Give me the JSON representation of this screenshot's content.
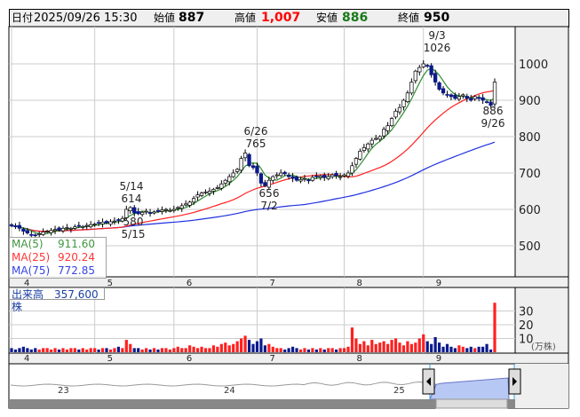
{
  "header": {
    "date_label": "日付",
    "date": "2025/09/26 15:30",
    "open_label": "始値",
    "open": "887",
    "high_label": "高値",
    "high": "1,007",
    "low_label": "安値",
    "low": "886",
    "close_label": "終値",
    "close": "950"
  },
  "colors": {
    "up": "#ffffff",
    "down": "#0a1a8c",
    "ma5": "#2e8b2e",
    "ma25": "#ff2020",
    "ma75": "#2030e0",
    "vol_up": "#ff2020",
    "vol_down": "#0a1a8c",
    "high_text": "#ff0000",
    "low_text": "#1a7a1a"
  },
  "legend": {
    "ma5_label": "MA(5)",
    "ma5": "911.60",
    "ma25_label": "MA(25)",
    "ma25": "920.24",
    "ma75_label": "MA(75)",
    "ma75": "772.85"
  },
  "volume_label": "出来高　357,600株",
  "volume_unit": "(万株)",
  "chart_data": {
    "type": "candlestick",
    "price_ticks": [
      500,
      600,
      700,
      800,
      900,
      1000
    ],
    "ylim": [
      420,
      1100
    ],
    "month_labels": [
      "4",
      "5",
      "6",
      "7",
      "8",
      "9"
    ],
    "month_start_index": [
      0,
      21,
      41,
      62,
      84,
      104
    ],
    "closes": [
      555,
      552,
      548,
      540,
      535,
      530,
      528,
      533,
      538,
      540,
      542,
      545,
      543,
      548,
      550,
      548,
      552,
      555,
      553,
      556,
      558,
      560,
      562,
      565,
      563,
      566,
      568,
      570,
      575,
      600,
      605,
      590,
      588,
      592,
      595,
      590,
      593,
      596,
      598,
      600,
      597,
      600,
      605,
      610,
      615,
      620,
      630,
      640,
      645,
      648,
      650,
      655,
      660,
      670,
      680,
      690,
      700,
      710,
      740,
      755,
      720,
      715,
      700,
      672,
      665,
      680,
      690,
      695,
      700,
      698,
      690,
      685,
      680,
      682,
      685,
      680,
      688,
      690,
      692,
      688,
      690,
      695,
      692,
      690,
      695,
      700,
      720,
      740,
      760,
      770,
      780,
      790,
      795,
      800,
      820,
      830,
      850,
      870,
      880,
      900,
      920,
      950,
      980,
      990,
      1000,
      995,
      970,
      950,
      930,
      920,
      915,
      910,
      905,
      910,
      915,
      905,
      900,
      910,
      905,
      900,
      895,
      886,
      950
    ],
    "volumes": [
      3,
      2,
      3,
      4,
      3,
      2,
      3,
      2,
      3,
      3,
      2,
      3,
      2,
      3,
      2,
      3,
      3,
      2,
      3,
      2,
      3,
      3,
      2,
      3,
      3,
      2,
      3,
      4,
      3,
      9,
      6,
      3,
      3,
      2,
      3,
      2,
      3,
      2,
      3,
      3,
      2,
      3,
      4,
      3,
      3,
      5,
      4,
      3,
      4,
      3,
      3,
      5,
      4,
      6,
      7,
      5,
      6,
      8,
      10,
      12,
      9,
      6,
      8,
      10,
      5,
      6,
      4,
      3,
      3,
      2,
      3,
      4,
      3,
      2,
      3,
      2,
      3,
      2,
      3,
      2,
      3,
      3,
      2,
      3,
      3,
      4,
      18,
      10,
      6,
      8,
      5,
      9,
      6,
      7,
      8,
      6,
      9,
      10,
      7,
      5,
      8,
      6,
      7,
      10,
      13,
      8,
      6,
      11,
      7,
      4,
      6,
      4,
      3,
      5,
      4,
      3,
      4,
      3,
      4,
      4,
      6,
      2,
      36
    ],
    "volume_ticks": [
      10,
      20,
      30
    ],
    "annotations": [
      {
        "date": "9/3",
        "price": "1026"
      },
      {
        "date": "6/26",
        "price": "765"
      },
      {
        "date": "5/14",
        "price": "614"
      },
      {
        "price": "580",
        "date": "5/15"
      },
      {
        "price": "656",
        "date": "7/2"
      },
      {
        "price": "886",
        "date": "9/26"
      }
    ],
    "navigator_labels": [
      "23",
      "24",
      "25"
    ]
  }
}
